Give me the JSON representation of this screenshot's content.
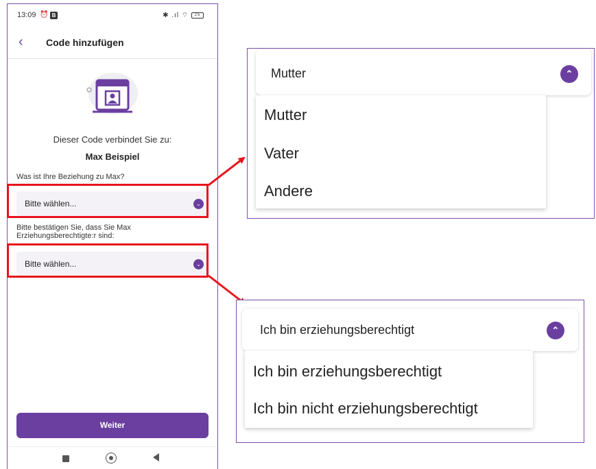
{
  "status_bar": {
    "time": "13:09",
    "time_icons": "⏰",
    "badge": "B",
    "right_icons": "✱ .ıl ⌔",
    "battery": "25"
  },
  "app_bar": {
    "title": "Code hinzufügen"
  },
  "intro": {
    "connect_text": "Dieser Code verbindet Sie zu:",
    "child_name": "Max Beispiel"
  },
  "question1": {
    "label": "Was ist Ihre Beziehung zu Max?",
    "select_value": "Bitte wählen..."
  },
  "question2": {
    "label_line1": "Bitte bestätigen Sie, dass Sie Max",
    "label_line2": "Erziehungsberechtigte:r sind:",
    "select_value": "Bitte wählen..."
  },
  "continue_button": "Weiter",
  "zoom_relationship": {
    "selected": "Mutter",
    "options": [
      "Mutter",
      "Vater",
      "Andere"
    ]
  },
  "zoom_guardian": {
    "selected": "Ich bin erziehungsberechtigt",
    "options": [
      "Ich bin erziehungsberechtigt",
      "Ich bin nicht erziehungsberechtigt"
    ]
  },
  "colors": {
    "accent": "#6a3fa0",
    "highlight": "#e8141b",
    "frame": "#7a4fa8"
  }
}
